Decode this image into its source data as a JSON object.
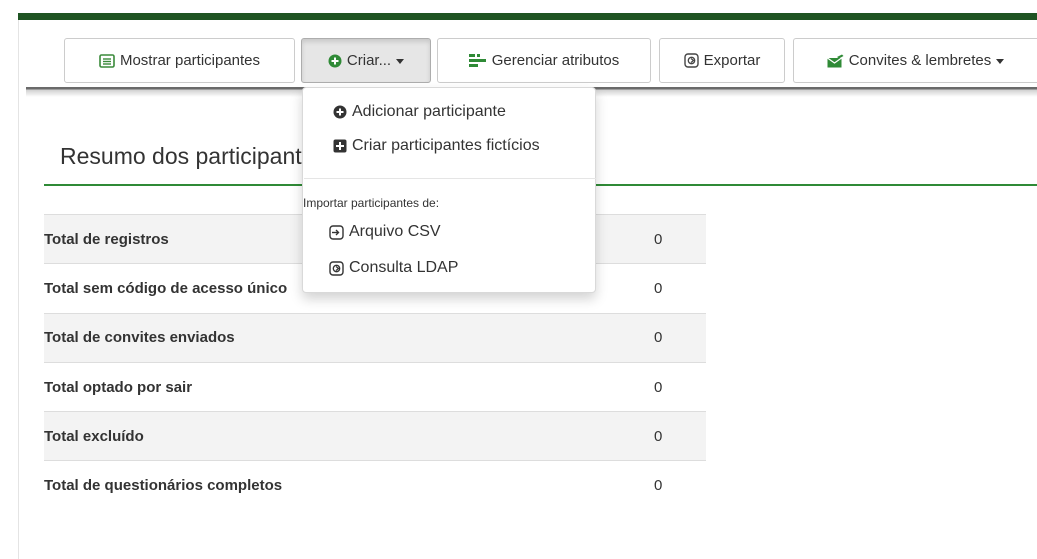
{
  "toolbar": {
    "show_participants": "Mostrar participantes",
    "create": "Criar...",
    "manage_attributes": "Gerenciar atributos",
    "export": "Exportar",
    "invitations": "Convites & lembretes"
  },
  "create_menu": {
    "add_participant": "Adicionar participante",
    "create_dummy": "Criar participantes fictícios",
    "import_header": "Importar participantes de:",
    "csv_file": "Arquivo CSV",
    "ldap_query": "Consulta LDAP"
  },
  "summary": {
    "title": "Resumo dos participantes",
    "rows": [
      {
        "label": "Total de registros",
        "value": "0"
      },
      {
        "label": "Total sem código de acesso único",
        "value": "0"
      },
      {
        "label": "Total de convites enviados",
        "value": "0"
      },
      {
        "label": "Total optado por sair",
        "value": "0"
      },
      {
        "label": "Total excluído",
        "value": "0"
      },
      {
        "label": "Total de questionários completos",
        "value": "0"
      }
    ]
  },
  "colors": {
    "topbar": "#1f5423",
    "accent_green": "#2f8a36",
    "icon_green": "#3a8a3a"
  },
  "icons": {
    "show_participants": "list-icon",
    "create": "plus-circle-icon",
    "manage_attributes": "attributes-icon",
    "export": "export-icon",
    "invitations": "envelope-icon",
    "add_participant": "plus-circle-icon",
    "create_dummy": "plus-square-icon",
    "csv_file": "import-icon",
    "ldap_query": "import-icon"
  }
}
